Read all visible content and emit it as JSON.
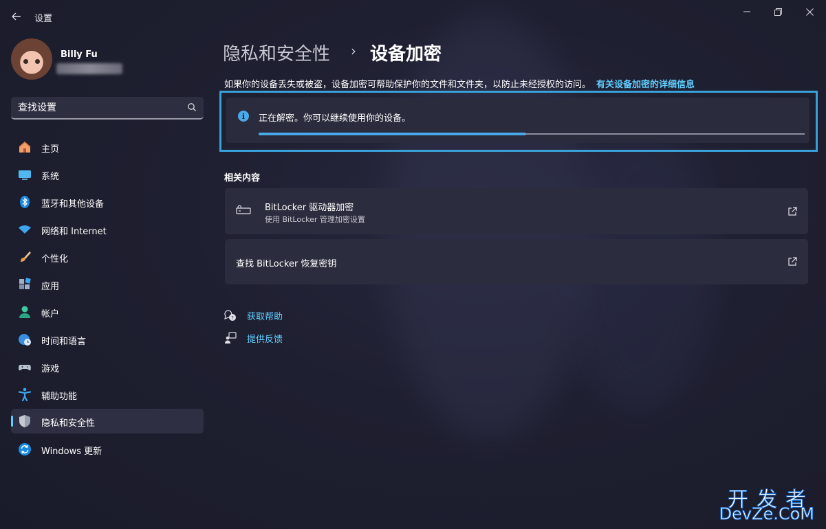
{
  "window": {
    "title": "设置",
    "back_icon": "back-arrow-icon",
    "controls": [
      "minimize-icon",
      "maximize-icon",
      "close-icon"
    ]
  },
  "user": {
    "name": "Billy Fu",
    "email": ""
  },
  "search": {
    "value": "查找设置",
    "icon": "search-icon"
  },
  "sidebar": {
    "items": [
      {
        "label": "主页",
        "icon": "home-icon"
      },
      {
        "label": "系统",
        "icon": "system-display-icon"
      },
      {
        "label": "蓝牙和其他设备",
        "icon": "bluetooth-icon"
      },
      {
        "label": "网络和 Internet",
        "icon": "wifi-icon"
      },
      {
        "label": "个性化",
        "icon": "brush-icon"
      },
      {
        "label": "应用",
        "icon": "apps-icon"
      },
      {
        "label": "帐户",
        "icon": "account-icon"
      },
      {
        "label": "时间和语言",
        "icon": "globe-clock-icon"
      },
      {
        "label": "游戏",
        "icon": "gamepad-icon"
      },
      {
        "label": "辅助功能",
        "icon": "accessibility-icon"
      },
      {
        "label": "隐私和安全性",
        "icon": "shield-icon",
        "active": true
      },
      {
        "label": "Windows 更新",
        "icon": "update-icon"
      }
    ]
  },
  "breadcrumb": {
    "parent": "隐私和安全性",
    "separator": "›",
    "current": "设备加密"
  },
  "description": {
    "text": "如果你的设备丢失或被盗，设备加密可帮助保护你的文件和文件夹，以防止未经授权的访问。",
    "link": "有关设备加密的详细信息"
  },
  "status": {
    "icon": "info-icon",
    "text": "正在解密。你可以继续使用你的设备。",
    "progress": 0.49
  },
  "related": {
    "title": "相关内容",
    "cards": [
      {
        "title": "BitLocker 驱动器加密",
        "subtitle": "使用 BitLocker 管理加密设置",
        "icon": "drive-lock-icon",
        "action_icon": "open-external-icon"
      },
      {
        "title": "查找 BitLocker 恢复密钥",
        "subtitle": "",
        "icon": "",
        "action_icon": "open-external-icon"
      }
    ]
  },
  "help": {
    "get_help": "获取帮助",
    "feedback": "提供反馈"
  },
  "watermark": {
    "line1": "开发者",
    "line2": "DevZe.CoM"
  },
  "colors": {
    "accent": "#60cdff",
    "highlight_border": "#3aa0d8",
    "background": "#1e1f30",
    "card": "#2b2c3d"
  }
}
